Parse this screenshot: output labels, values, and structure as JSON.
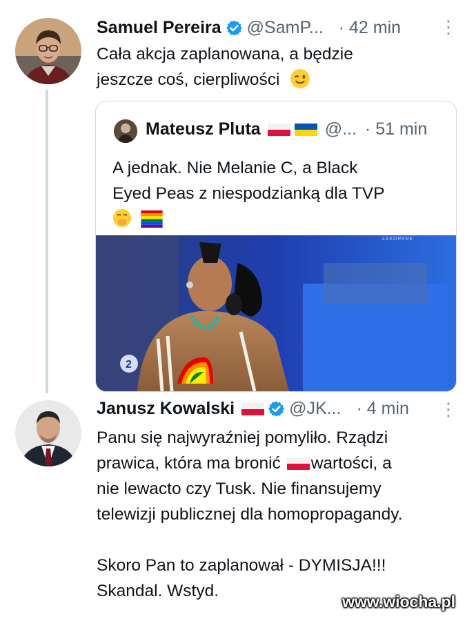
{
  "tweet1": {
    "name": "Samuel Pereira",
    "handle": "@SamP...",
    "time": "· 42 min",
    "more": "⋮",
    "lines": [
      "Cała akcja zaplanowana, a będzie",
      "jeszcze coś, cierpliwości"
    ],
    "emoji": "wink-emoji"
  },
  "quote": {
    "name": "Mateusz Pluta",
    "handle": "@...",
    "time": "· 51 min",
    "lines": [
      "A jednak. Nie Melanie C, a Black",
      "Eyed Peas z niespodzianką dla TVP"
    ],
    "emojis": [
      "hand-over-mouth-emoji",
      "rainbow-flag-emoji"
    ],
    "media_tag": "ZAKOPANE",
    "media_logo": "2"
  },
  "tweet2": {
    "name": "Janusz Kowalski",
    "handle": "@JK...",
    "time": "· 4 min",
    "more": "⋮",
    "line1": "Panu się najwyraźniej pomyliło. Rządzi",
    "line2_a": "prawica, która ma bronić",
    "line2_b": "wartości, a",
    "line3": "nie lewacto czy Tusk. Nie finansujemy",
    "line4": "telewizji publicznej dla homopropagandy.",
    "line5": "Skoro Pan to zaplanował - DYMISJA!!!",
    "line6": "Skandal. Wstyd."
  },
  "watermark": "www.wiocha.pl",
  "colors": {
    "verified": "#1d9bf0",
    "secondary_text": "#536471",
    "border": "#cfd9de",
    "flag_red": "#dc143c",
    "flag_blue": "#0057b7",
    "flag_yellow": "#ffd700"
  }
}
